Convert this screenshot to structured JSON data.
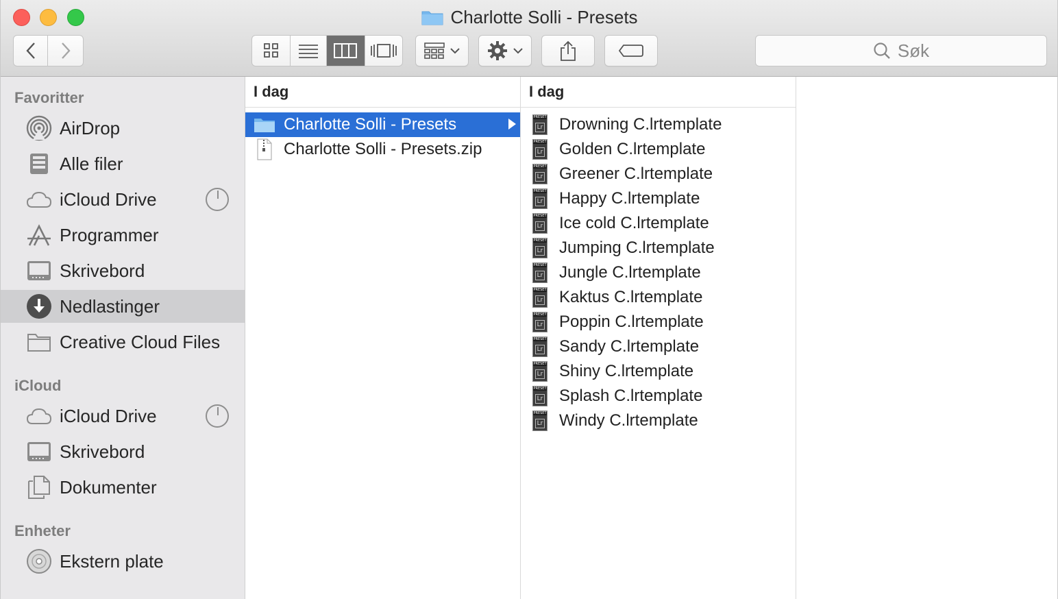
{
  "window": {
    "title": "Charlotte Solli - Presets"
  },
  "toolbar": {
    "back_icon": "chevron-left-icon",
    "forward_icon": "chevron-right-icon",
    "view_modes": [
      "icon-view",
      "list-view",
      "column-view",
      "coverflow-view"
    ],
    "active_view": "column-view",
    "search_placeholder": "Søk"
  },
  "sidebar": {
    "sections": [
      {
        "title": "Favoritter",
        "items": [
          {
            "label": "AirDrop",
            "icon": "airdrop-icon"
          },
          {
            "label": "Alle filer",
            "icon": "all-files-icon"
          },
          {
            "label": "iCloud Drive",
            "icon": "cloud-icon",
            "has_progress": true
          },
          {
            "label": "Programmer",
            "icon": "applications-icon"
          },
          {
            "label": "Skrivebord",
            "icon": "desktop-icon"
          },
          {
            "label": "Nedlastinger",
            "icon": "downloads-icon",
            "selected": true
          },
          {
            "label": "Creative Cloud Files",
            "icon": "folder-icon"
          }
        ]
      },
      {
        "title": "iCloud",
        "items": [
          {
            "label": "iCloud Drive",
            "icon": "cloud-icon",
            "has_progress": true
          },
          {
            "label": "Skrivebord",
            "icon": "desktop-icon"
          },
          {
            "label": "Dokumenter",
            "icon": "documents-icon"
          }
        ]
      },
      {
        "title": "Enheter",
        "items": [
          {
            "label": "Ekstern plate",
            "icon": "disc-icon"
          }
        ]
      }
    ]
  },
  "columns": [
    {
      "header": "I dag",
      "items": [
        {
          "label": "Charlotte Solli - Presets",
          "icon": "folder-icon",
          "selected": true
        },
        {
          "label": "Charlotte Solli - Presets.zip",
          "icon": "zip-file-icon"
        }
      ]
    },
    {
      "header": "I dag",
      "items": [
        {
          "label": "Drowning C.lrtemplate"
        },
        {
          "label": "Golden C.lrtemplate"
        },
        {
          "label": "Greener C.lrtemplate"
        },
        {
          "label": "Happy C.lrtemplate"
        },
        {
          "label": "Ice cold C.lrtemplate"
        },
        {
          "label": "Jumping C.lrtemplate"
        },
        {
          "label": "Jungle C.lrtemplate"
        },
        {
          "label": "Kaktus C.lrtemplate"
        },
        {
          "label": "Poppin C.lrtemplate"
        },
        {
          "label": "Sandy C.lrtemplate"
        },
        {
          "label": "Shiny C.lrtemplate"
        },
        {
          "label": "Splash C.lrtemplate"
        },
        {
          "label": "Windy C.lrtemplate"
        }
      ],
      "item_icon": "preset-file-icon",
      "icon_caption": "PRESET",
      "icon_glyph": "Lr"
    }
  ]
}
